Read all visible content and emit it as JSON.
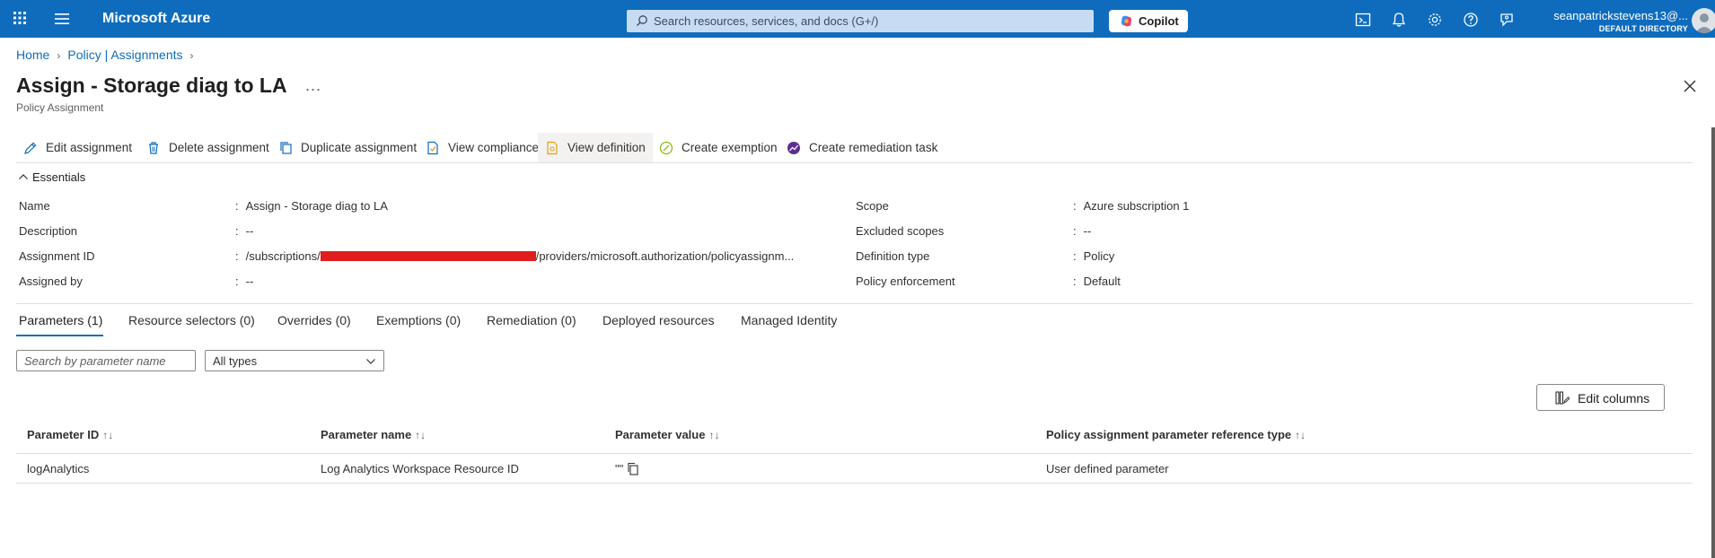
{
  "topbar": {
    "brand": "Microsoft Azure",
    "search_placeholder": "Search resources, services, and docs (G+/)",
    "copilot_label": "Copilot",
    "user_name": "seanpatrickstevens13@...",
    "user_directory": "DEFAULT DIRECTORY",
    "icons": [
      "waffle-icon",
      "hamburger-icon",
      "cloud-shell-icon",
      "bell-icon",
      "gear-icon",
      "help-icon",
      "feedback-icon"
    ]
  },
  "breadcrumb": {
    "items": [
      "Home",
      "Policy | Assignments"
    ]
  },
  "page": {
    "title": "Assign - Storage diag to LA",
    "more": "...",
    "subtitle": "Policy Assignment"
  },
  "commands": [
    {
      "label": "Edit assignment",
      "icon": "pencil-icon"
    },
    {
      "label": "Delete assignment",
      "icon": "trash-icon"
    },
    {
      "label": "Duplicate assignment",
      "icon": "duplicate-icon"
    },
    {
      "label": "View compliance",
      "icon": "compliance-icon"
    },
    {
      "label": "View definition",
      "icon": "definition-icon"
    },
    {
      "label": "Create exemption",
      "icon": "exemption-icon"
    },
    {
      "label": "Create remediation task",
      "icon": "remediation-icon"
    }
  ],
  "essentials": {
    "header": "Essentials",
    "left": [
      {
        "label": "Name",
        "value": "Assign - Storage diag to LA"
      },
      {
        "label": "Description",
        "value": "--"
      },
      {
        "label": "Assignment ID",
        "value_prefix": "/subscriptions/",
        "value_suffix": "/providers/microsoft.authorization/policyassignm..."
      },
      {
        "label": "Assigned by",
        "value": "--"
      }
    ],
    "right": [
      {
        "label": "Scope",
        "value": "Azure subscription 1"
      },
      {
        "label": "Excluded scopes",
        "value": "--"
      },
      {
        "label": "Definition type",
        "value": "Policy"
      },
      {
        "label": "Policy enforcement",
        "value": "Default"
      }
    ]
  },
  "tabs": [
    "Parameters (1)",
    "Resource selectors (0)",
    "Overrides (0)",
    "Exemptions (0)",
    "Remediation (0)",
    "Deployed resources",
    "Managed Identity"
  ],
  "filters": {
    "search_placeholder": "Search by parameter name",
    "type_value": "All types"
  },
  "edit_columns_label": "Edit columns",
  "table": {
    "headers": [
      "Parameter ID",
      "Parameter name",
      "Parameter value",
      "Policy assignment parameter reference type"
    ],
    "sort_glyph": "↑↓",
    "rows": [
      {
        "id": "logAnalytics",
        "name": "Log Analytics Workspace Resource ID",
        "value": "\"\"",
        "ref_type": "User defined parameter"
      }
    ]
  },
  "colors": {
    "topbar": "#0f6cbd",
    "link": "#0f6cbd",
    "redaction": "#e11d1d"
  }
}
